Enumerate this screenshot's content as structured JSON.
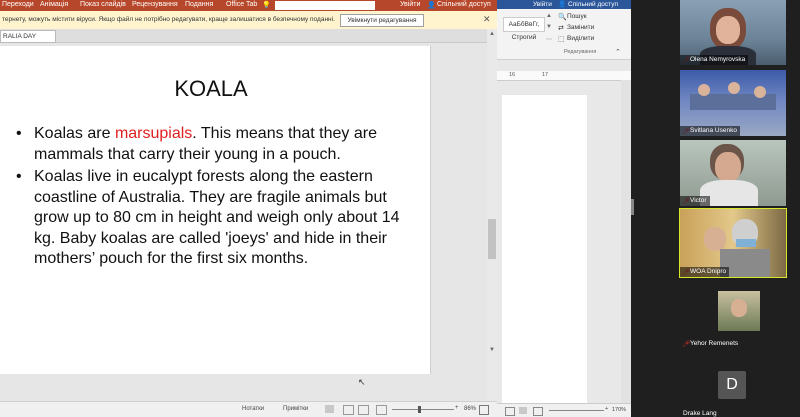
{
  "ppt": {
    "tabs": [
      "Переходи",
      "Анімація",
      "Показ слайдів",
      "Рецензування",
      "Подання",
      "Office Tab"
    ],
    "signin": "Увійти",
    "share": "Спільний доступ",
    "warning": "тернету, можуть містити віруси. Якщо файл не потрібно редагувати, краще залишатися в безпечному поданні.",
    "enable_button": "Увімкнути редагування",
    "slide_tab": "RALIA DAY",
    "status_notes": "Нотатки",
    "status_comments": "Примітки",
    "zoom": "86%"
  },
  "slide": {
    "title": "KOALA",
    "bullet1_pre": "Koalas are ",
    "bullet1_highlight": "marsupials",
    "bullet1_post": ". This means that they are mammals that carry their young in a pouch.",
    "bullet2": "Koalas live in eucalypt forests along the eastern coastline of Australia. They are fragile animals but grow up to 80 cm in height and weigh only about 14 kg. Baby koalas are called 'joeys' and hide in their mothers’ pouch for the first six months."
  },
  "word": {
    "signin": "Увійти",
    "share": "Спільний доступ",
    "style_sample": "АаБбВвГг,",
    "style_name": "Строгий",
    "find": "Пошук",
    "replace": "Замінити",
    "select": "Виділити",
    "group_editing": "Редагування",
    "ruler_a": "16",
    "ruler_b": "17",
    "zoom": "170%"
  },
  "participants": [
    {
      "name": "Olena Nemyrovska"
    },
    {
      "name": "Svitlana Usenko"
    },
    {
      "name": "Victor"
    },
    {
      "name": "WOA Dnipro"
    },
    {
      "name": "Yehor Remenets"
    },
    {
      "name": "Drake Lang",
      "initial": "D"
    }
  ],
  "colors": {
    "ppt_ribbon": "#b7472a",
    "word_ribbon": "#2b579a",
    "highlight": "#e02020",
    "active_speaker": "#d6e82a"
  }
}
